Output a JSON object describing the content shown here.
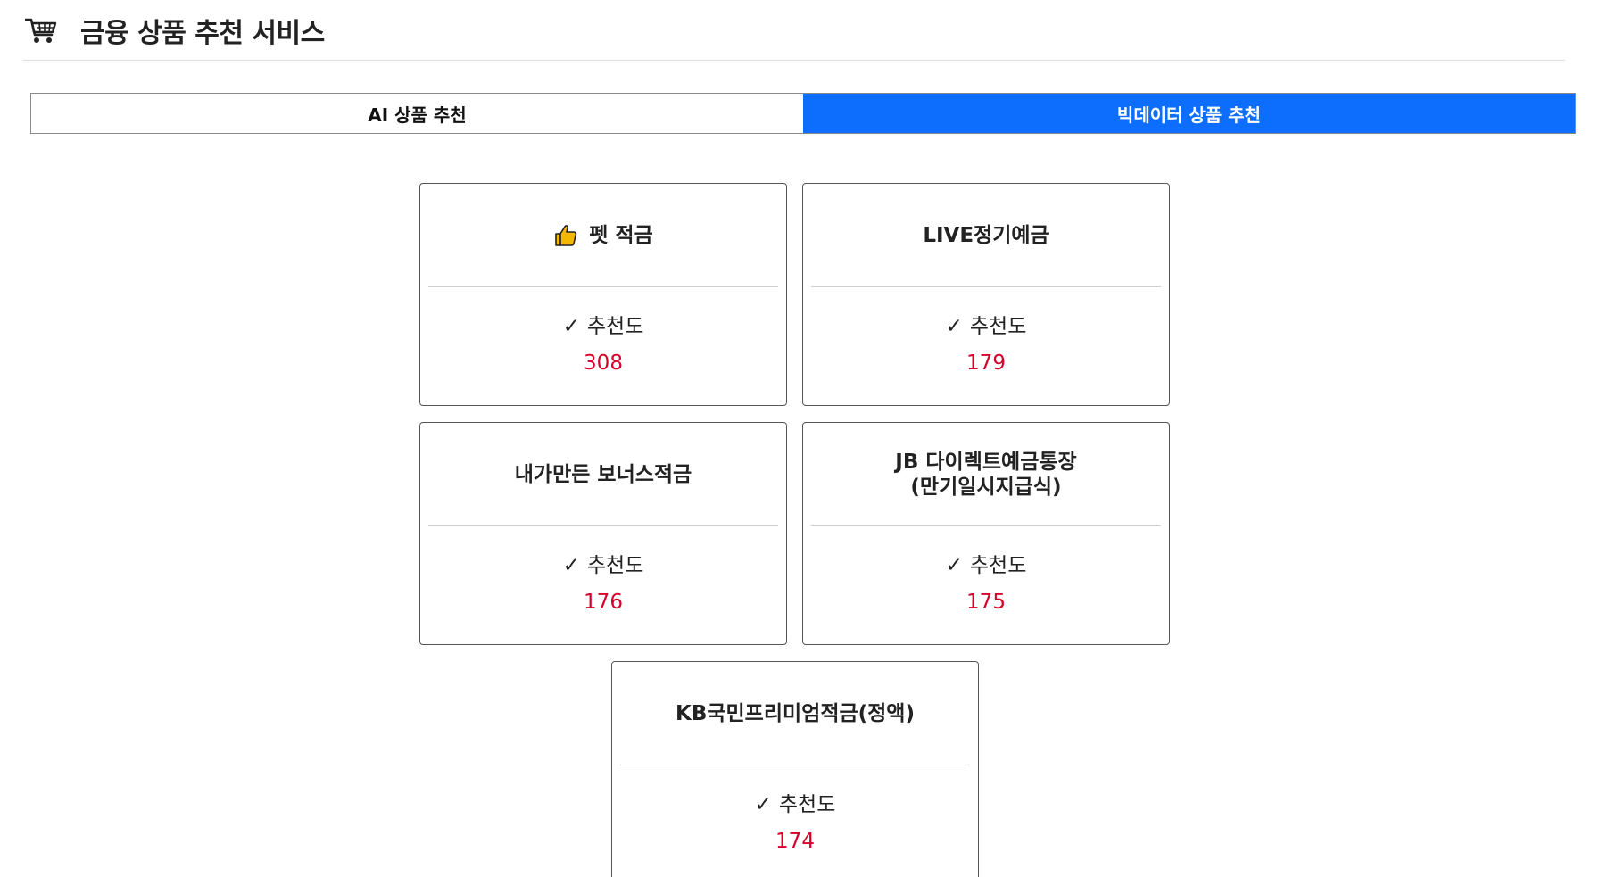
{
  "header": {
    "title": "금융 상품 추천 서비스",
    "icon": "shopping-cart-icon"
  },
  "tabs": [
    {
      "label": "AI 상품 추천",
      "active": false
    },
    {
      "label": "빅데이터 상품 추천",
      "active": true
    }
  ],
  "colors": {
    "accent": "#0d6efd",
    "score": "#d6002b"
  },
  "recommend_label": "추천도",
  "check_mark": "✓",
  "products": [
    {
      "name": "펫 적금",
      "score": "308",
      "icon": "thumbs-up-icon"
    },
    {
      "name": "LIVE정기예금",
      "score": "179"
    },
    {
      "name": "내가만든 보너스적금",
      "score": "176"
    },
    {
      "name": "JB 다이렉트예금통장 (만기일시지급식)",
      "score": "175"
    },
    {
      "name": "KB국민프리미엄적금(정액)",
      "score": "174"
    }
  ]
}
